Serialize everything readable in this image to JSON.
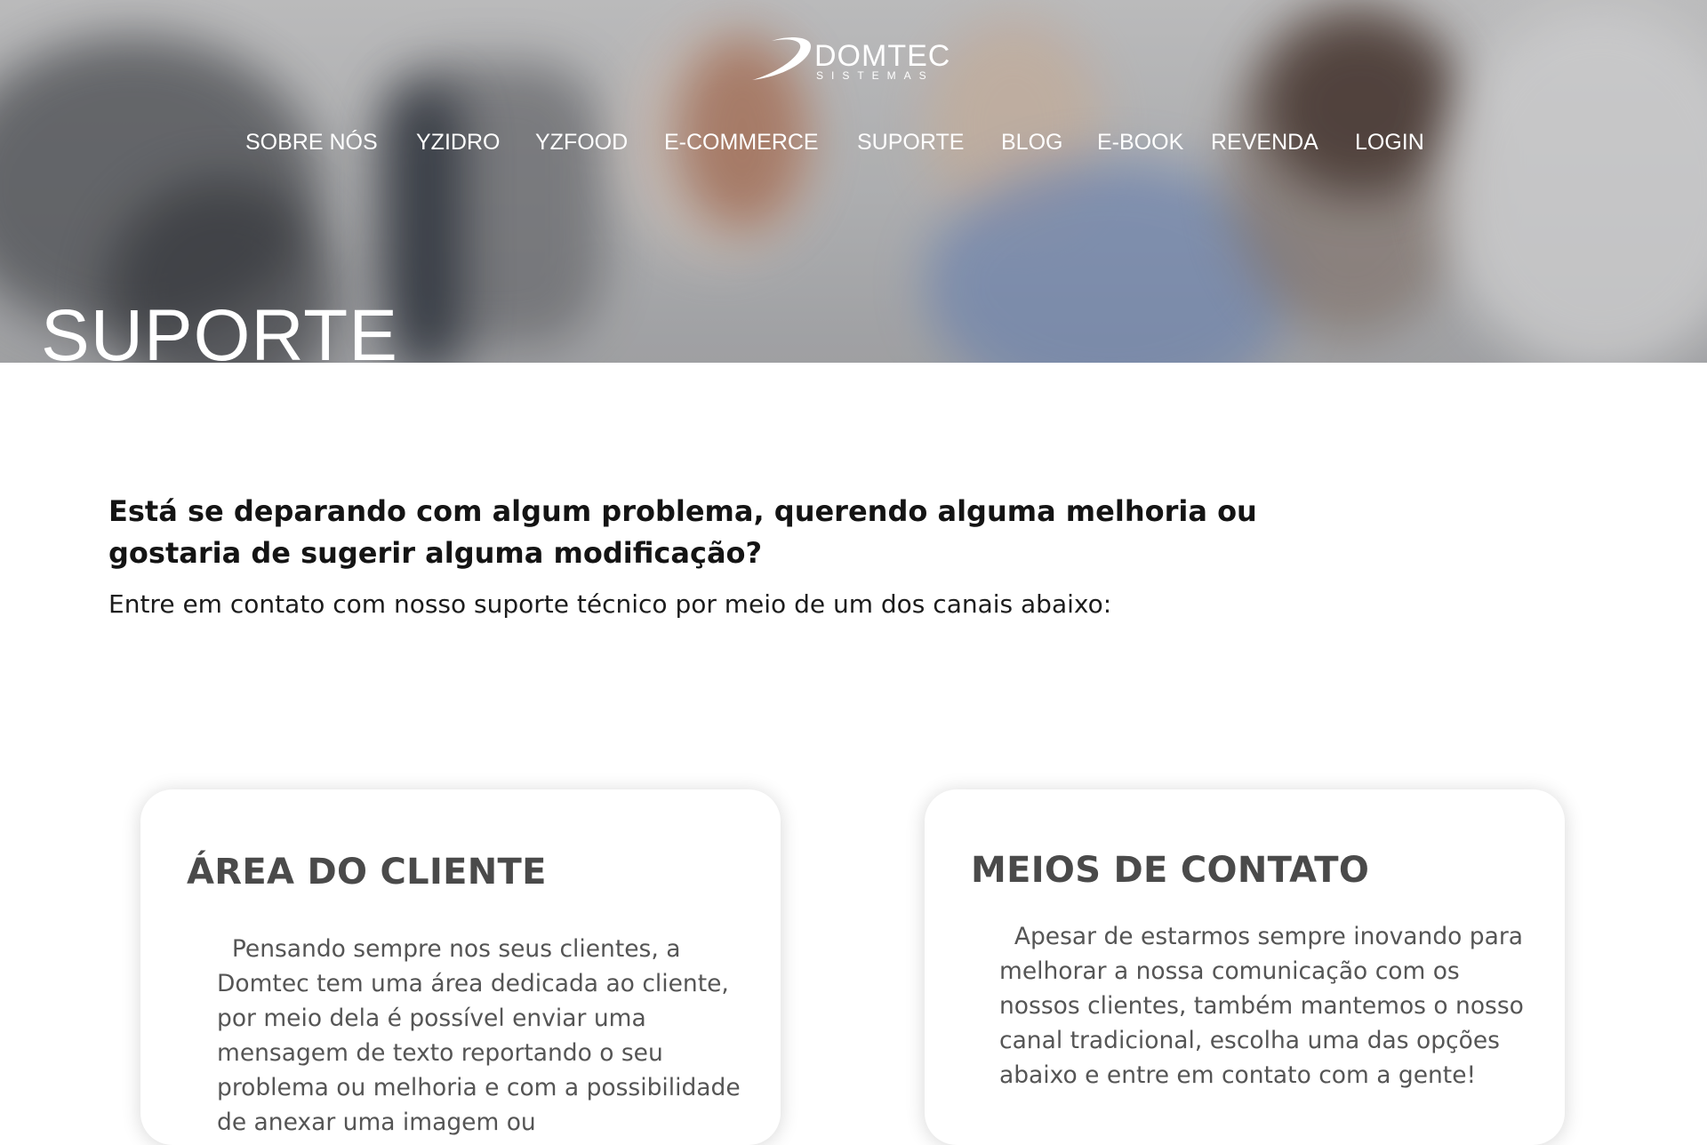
{
  "brand": {
    "name": "DOMTEC",
    "tagline": "SISTEMAS"
  },
  "nav": {
    "items": [
      {
        "label": "SOBRE NÓS"
      },
      {
        "label": "YZIDRO"
      },
      {
        "label": "YZFOOD"
      },
      {
        "label": "E-COMMERCE"
      },
      {
        "label": "SUPORTE"
      },
      {
        "label": "BLOG"
      },
      {
        "label": "E-BOOK"
      },
      {
        "label": "REVENDA"
      },
      {
        "label": "LOGIN"
      }
    ]
  },
  "hero": {
    "title": "SUPORTE"
  },
  "intro": {
    "question": "Está se deparando com algum problema, querendo alguma melhoria ou gostaria de sugerir alguma modificação?",
    "subtitle": "Entre em contato com nosso suporte técnico por meio de um dos canais abaixo:"
  },
  "cards": [
    {
      "title": "ÁREA DO CLIENTE",
      "text": "  Pensando sempre nos seus clientes, a Domtec tem uma área dedicada ao cliente, por meio dela é possível enviar uma mensagem de texto reportando o seu problema ou melhoria e com a possibilidade de anexar uma imagem ou"
    },
    {
      "title": "MEIOS DE CONTATO",
      "text": "  Apesar de estarmos sempre inovando para melhorar a nossa comunicação com os nossos clientes, também mantemos o nosso canal tradicional, escolha uma das opções abaixo e entre em contato com a gente!"
    }
  ],
  "colors": {
    "heading": "#141414",
    "card_title": "#4a4a4a",
    "card_text": "#555555",
    "nav_text": "#ffffff"
  }
}
